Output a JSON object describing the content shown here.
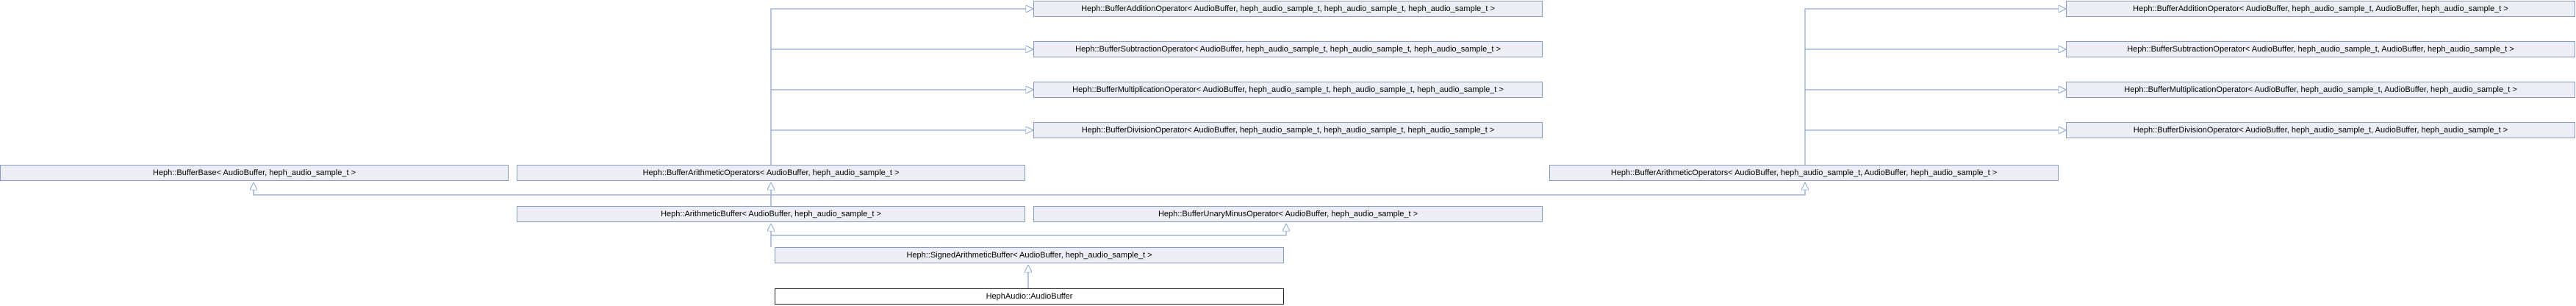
{
  "colors": {
    "node_fill": "#ebeef5",
    "node_border": "#8a9ab8",
    "edge": "#8ea8d2",
    "main_fill": "#ffffff",
    "main_border": "#222222"
  },
  "nodes": {
    "add_left": "Heph::BufferAdditionOperator< AudioBuffer, heph_audio_sample_t, heph_audio_sample_t, heph_audio_sample_t >",
    "sub_left": "Heph::BufferSubtractionOperator< AudioBuffer, heph_audio_sample_t, heph_audio_sample_t, heph_audio_sample_t >",
    "mul_left": "Heph::BufferMultiplicationOperator< AudioBuffer, heph_audio_sample_t, heph_audio_sample_t, heph_audio_sample_t >",
    "div_left": "Heph::BufferDivisionOperator< AudioBuffer, heph_audio_sample_t, heph_audio_sample_t, heph_audio_sample_t >",
    "add_right": "Heph::BufferAdditionOperator< AudioBuffer, heph_audio_sample_t, AudioBuffer, heph_audio_sample_t >",
    "sub_right": "Heph::BufferSubtractionOperator< AudioBuffer, heph_audio_sample_t, AudioBuffer, heph_audio_sample_t >",
    "mul_right": "Heph::BufferMultiplicationOperator< AudioBuffer, heph_audio_sample_t, AudioBuffer, heph_audio_sample_t >",
    "div_right": "Heph::BufferDivisionOperator< AudioBuffer, heph_audio_sample_t, AudioBuffer, heph_audio_sample_t >",
    "buffer_base": "Heph::BufferBase< AudioBuffer, heph_audio_sample_t >",
    "arith_ops_left": "Heph::BufferArithmeticOperators< AudioBuffer, heph_audio_sample_t >",
    "arith_ops_right": "Heph::BufferArithmeticOperators< AudioBuffer, heph_audio_sample_t, AudioBuffer, heph_audio_sample_t >",
    "arithmetic_buffer": "Heph::ArithmeticBuffer< AudioBuffer, heph_audio_sample_t >",
    "unary_minus": "Heph::BufferUnaryMinusOperator< AudioBuffer, heph_audio_sample_t >",
    "signed_arith": "Heph::SignedArithmeticBuffer< AudioBuffer, heph_audio_sample_t >",
    "audio_buffer": "HephAudio::AudioBuffer"
  }
}
